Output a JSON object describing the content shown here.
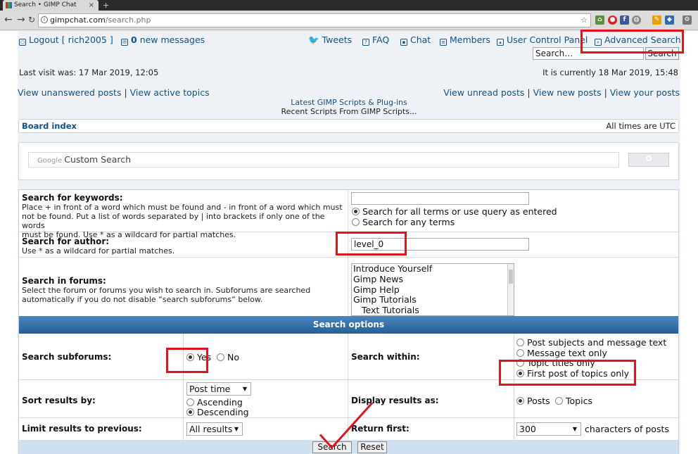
{
  "browser": {
    "tab_title": "Search • GIMP Chat",
    "url_host": "gimpchat.com",
    "url_path": "/search.php"
  },
  "header": {
    "logout_label": "Logout [ rich2005 ]",
    "messages_count": "0",
    "messages_label": "new messages",
    "tweets": "Tweets",
    "faq": "FAQ",
    "chat": "Chat",
    "members": "Members",
    "ucp": "User Control Panel",
    "advanced_search": "Advanced Search",
    "search_placeholder": "Search…",
    "search_button": "Search"
  },
  "info": {
    "last_visit": "Last visit was: 17 Mar 2019, 12:05",
    "current_time": "It is currently 18 Mar 2019, 15:48"
  },
  "navlinks": {
    "unanswered": "View unanswered posts",
    "active": "View active topics",
    "unread": "View unread posts",
    "new_posts": "View new posts",
    "your_posts": "View your posts",
    "sep": "|"
  },
  "scripts": {
    "latest": "Latest GIMP Scripts & Plug-ins",
    "recent": "Recent Scripts From GIMP Scripts..."
  },
  "breadcrumb": {
    "board_index": "Board index",
    "timezone": "All times are UTC"
  },
  "google_search": {
    "brand": "Google",
    "placeholder": "Custom Search"
  },
  "form": {
    "keywords_label": "Search for keywords:",
    "keywords_desc_1": "Place + in front of a word which must be found and - in front of a word which must",
    "keywords_desc_2": "not be found. Put a list of words separated by | into brackets if only one of the words",
    "keywords_desc_3": "must be found. Use * as a wildcard for partial matches.",
    "keywords_value": "",
    "terms_all": "Search for all terms or use query as entered",
    "terms_any": "Search for any terms",
    "author_label": "Search for author:",
    "author_desc": "Use * as a wildcard for partial matches.",
    "author_value": "level_0",
    "forums_label": "Search in forums:",
    "forums_desc_1": "Select the forum or forums you wish to search in. Subforums are searched",
    "forums_desc_2": "automatically if you do not disable “search subforums“ below.",
    "forums": [
      "Introduce Yourself",
      "Gimp News",
      "Gimp Help",
      "Gimp Tutorials",
      "Text Tutorials"
    ],
    "options_header": "Search options",
    "subforums_label": "Search subforums:",
    "yes": "Yes",
    "no": "No",
    "within_label": "Search within:",
    "within_options": [
      "Post subjects and message text",
      "Message text only",
      "Topic titles only",
      "First post of topics only"
    ],
    "sort_label": "Sort results by:",
    "sort_value": "Post time",
    "ascending": "Ascending",
    "descending": "Descending",
    "display_label": "Display results as:",
    "display_posts": "Posts",
    "display_topics": "Topics",
    "limit_label": "Limit results to previous:",
    "limit_value": "All results",
    "return_label": "Return first:",
    "return_value": "300",
    "return_suffix": "characters of posts",
    "search_button": "Search",
    "reset_button": "Reset"
  },
  "colors": {
    "link": "#105289",
    "annotation": "#e2131b",
    "options_bar": "#255f95"
  }
}
